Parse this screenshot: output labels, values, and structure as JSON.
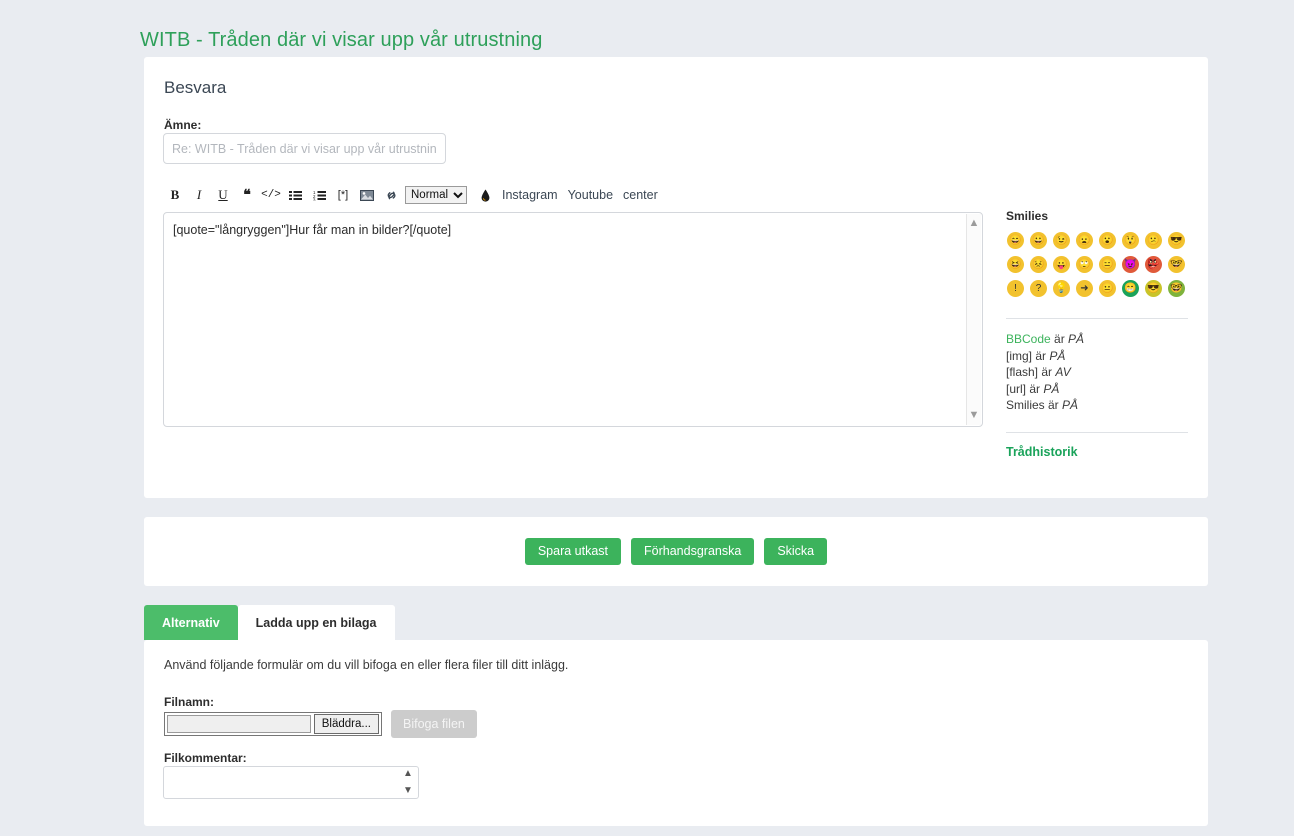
{
  "header": {
    "title": "WITB - Tråden där vi visar upp vår utrustning",
    "title_color": "#2ea05a"
  },
  "theme": {
    "page_background": "#e9ecf1",
    "accent_green": "#3cb35c",
    "card_background": "#ffffff"
  },
  "reply_panel": {
    "heading": "Besvara",
    "subject": {
      "label": "Ämne:",
      "value": "",
      "placeholder": "Re: WITB - Tråden där vi visar upp vår utrustnin"
    },
    "toolbar": {
      "bold": "B",
      "italic": "I",
      "underline": "U",
      "quote": "❝",
      "code": "</>",
      "list_bullet": "list-bullet-icon",
      "list_numbered": "list-numbered-icon",
      "list_item": "[*]",
      "image": "image-icon",
      "link": "link-icon",
      "format_select_value": "Normal",
      "format_options": [
        "Normal"
      ],
      "color_drop": "ink-drop-icon",
      "instagram": "Instagram",
      "youtube": "Youtube",
      "center": "center"
    },
    "message": {
      "value": "[quote=\"långryggen\"]Hur får man in bilder?[/quote]"
    },
    "smilies": {
      "title": "Smilies",
      "items": [
        {
          "name": "smiley-grin",
          "glyph": "😄",
          "color": "#f2c22e"
        },
        {
          "name": "smiley-smile",
          "glyph": "😀",
          "color": "#f2c22e"
        },
        {
          "name": "smiley-wink",
          "glyph": "😉",
          "color": "#f2c22e"
        },
        {
          "name": "smiley-sad",
          "glyph": "😦",
          "color": "#f2c22e"
        },
        {
          "name": "smiley-surprised",
          "glyph": "😮",
          "color": "#f2c22e"
        },
        {
          "name": "smiley-shocked",
          "glyph": "😲",
          "color": "#f2c22e"
        },
        {
          "name": "smiley-confused",
          "glyph": "😕",
          "color": "#f2c22e"
        },
        {
          "name": "smiley-cool",
          "glyph": "😎",
          "color": "#f2c22e"
        },
        {
          "name": "smiley-laugh",
          "glyph": "😆",
          "color": "#f2c22e"
        },
        {
          "name": "smiley-mad",
          "glyph": "😣",
          "color": "#f2c22e"
        },
        {
          "name": "smiley-tongue",
          "glyph": "😛",
          "color": "#f2c22e"
        },
        {
          "name": "smiley-rolleyes",
          "glyph": "🙄",
          "color": "#f2c22e"
        },
        {
          "name": "smiley-sleep",
          "glyph": "😑",
          "color": "#f2c22e"
        },
        {
          "name": "smiley-devil",
          "glyph": "😈",
          "color": "#e05a3a"
        },
        {
          "name": "smiley-evil",
          "glyph": "👺",
          "color": "#e05a3a"
        },
        {
          "name": "smiley-geek",
          "glyph": "🤓",
          "color": "#f2c22e"
        },
        {
          "name": "smiley-exclaim",
          "glyph": "!",
          "color": "#f2c22e"
        },
        {
          "name": "smiley-question",
          "glyph": "?",
          "color": "#f2c22e"
        },
        {
          "name": "smiley-idea",
          "glyph": "💡",
          "color": "#f2c22e"
        },
        {
          "name": "smiley-arrow",
          "glyph": "➜",
          "color": "#f2c22e"
        },
        {
          "name": "smiley-neutral",
          "glyph": "😐",
          "color": "#f2c22e"
        },
        {
          "name": "smiley-green-grin",
          "glyph": "😁",
          "color": "#1aa35a"
        },
        {
          "name": "smiley-shades",
          "glyph": "😎",
          "color": "#c9c42a"
        },
        {
          "name": "smiley-nerd",
          "glyph": "🤓",
          "color": "#7fb33c"
        }
      ]
    },
    "bbcode_status": [
      {
        "tag": "BBCode",
        "is_link": true,
        "verb": "är",
        "state": "PÅ"
      },
      {
        "tag": "[img]",
        "is_link": false,
        "verb": "är",
        "state": "PÅ"
      },
      {
        "tag": "[flash]",
        "is_link": false,
        "verb": "är",
        "state": "AV"
      },
      {
        "tag": "[url]",
        "is_link": false,
        "verb": "är",
        "state": "PÅ"
      },
      {
        "tag": "Smilies",
        "is_link": false,
        "verb": "är",
        "state": "PÅ"
      }
    ],
    "thread_history_link": "Trådhistorik"
  },
  "actions": {
    "save_draft": "Spara utkast",
    "preview": "Förhandsgranska",
    "submit": "Skicka"
  },
  "tabs": [
    {
      "label": "Alternativ",
      "active": true
    },
    {
      "label": "Ladda upp en bilaga",
      "active": false
    }
  ],
  "attachment_panel": {
    "intro": "Använd följande formulär om du vill bifoga en eller flera filer till ditt inlägg.",
    "filename_label": "Filnamn:",
    "filename_value": "",
    "browse_button": "Bläddra...",
    "attach_button": "Bifoga filen",
    "comment_label": "Filkommentar:",
    "comment_value": ""
  }
}
